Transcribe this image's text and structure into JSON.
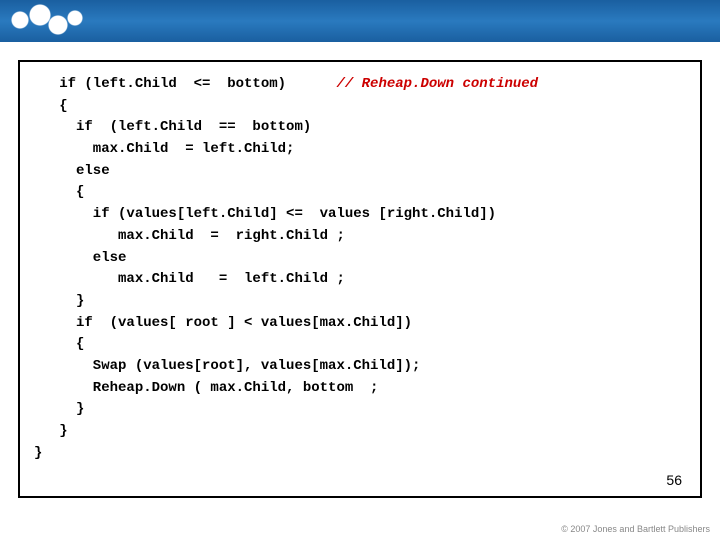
{
  "slide": {
    "page_number": "56",
    "footer_text": "© 2007 Jones and Bartlett Publishers",
    "code": {
      "line1_code": "   if (left.Child  <=  bottom)      ",
      "line1_comment": "// Reheap.Down continued",
      "line2": "   {",
      "line3": "     if  (left.Child  ==  bottom)",
      "line4": "       max.Child  = left.Child;",
      "line5": "     else",
      "line6": "     {",
      "line7": "       if (values[left.Child] <=  values [right.Child])",
      "line8": "          max.Child  =  right.Child ;",
      "line9": "       else",
      "line10": "          max.Child   =  left.Child ;",
      "line11": "     }",
      "line12": "     if  (values[ root ] < values[max.Child])",
      "line13": "     {",
      "line14": "       Swap (values[root], values[max.Child]);",
      "line15": "       Reheap.Down ( max.Child, bottom  ;",
      "line16": "     }",
      "line17": "   }",
      "line18": "}"
    }
  }
}
